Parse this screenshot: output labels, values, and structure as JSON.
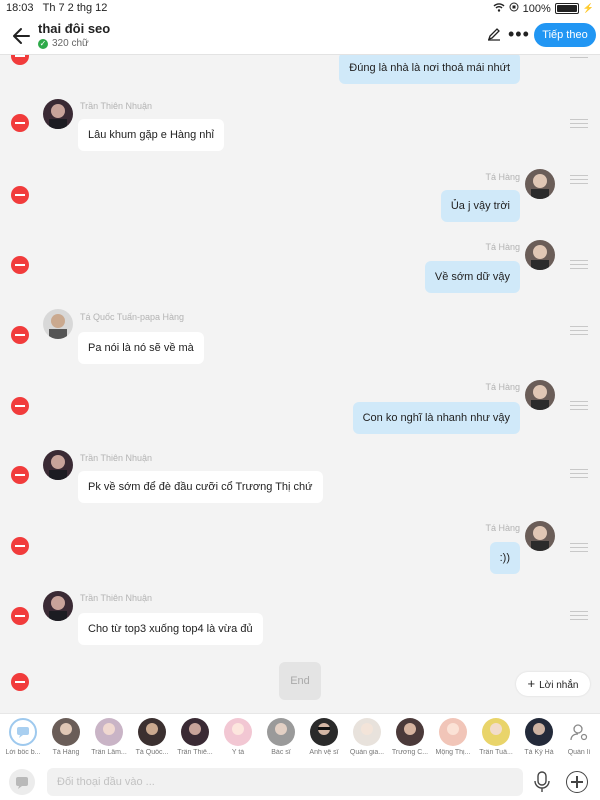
{
  "status": {
    "time": "18:03",
    "date": "Th 7 2 thg 12",
    "battery": "100%"
  },
  "header": {
    "title": "thai đôi seo",
    "subtitle": "320 chữ",
    "next_label": "Tiếp theo"
  },
  "messages": [
    {
      "side": "right",
      "name": "",
      "text": "Đúng là nhà là nơi thoả mái nhứt"
    },
    {
      "side": "left",
      "name": "Trần Thiên Nhuận",
      "text": "Lâu khum gặp e Hàng nhỉ"
    },
    {
      "side": "right",
      "name": "Tá Hàng",
      "text": "Ủa j vậy trời"
    },
    {
      "side": "right",
      "name": "Tá Hàng",
      "text": "Về sớm dữ vậy"
    },
    {
      "side": "left",
      "name": "Tá Quốc Tuấn-papa Hàng",
      "text": "Pa nói là nó sẽ về mà"
    },
    {
      "side": "right",
      "name": "Tá Hàng",
      "text": "Con ko nghĩ là nhanh như vậy"
    },
    {
      "side": "left",
      "name": "Trần Thiên Nhuận",
      "text": "Pk về sớm để đè đầu cưỡi cổ Trương Thị chứ"
    },
    {
      "side": "right",
      "name": "Tá Hàng",
      "text": ":))"
    },
    {
      "side": "left",
      "name": "Trần Thiên Nhuận",
      "text": "Cho từ top3 xuống top4 là vừa đủ"
    }
  ],
  "end_label": "End",
  "reply_label": "Lời nhắn",
  "characters": [
    {
      "label": "Lời bốc b..."
    },
    {
      "label": "Tá Hàng"
    },
    {
      "label": "Trần Lâm..."
    },
    {
      "label": "Tá Quốc..."
    },
    {
      "label": "Trần Thiê..."
    },
    {
      "label": "Y tá"
    },
    {
      "label": "Bác sĩ"
    },
    {
      "label": "Anh vệ sĩ"
    },
    {
      "label": "Quản gia..."
    },
    {
      "label": "Trương C..."
    },
    {
      "label": "Mộng Thị..."
    },
    {
      "label": "Trần Tuấ..."
    },
    {
      "label": "Tá Kỳ Hà"
    },
    {
      "label": "Quản lí"
    }
  ],
  "input": {
    "placeholder": "Đối thoại đầu vào ..."
  },
  "colors": {
    "accent": "#2196f3",
    "delete": "#f13b3b",
    "bubble_right": "#d0e9f9"
  }
}
